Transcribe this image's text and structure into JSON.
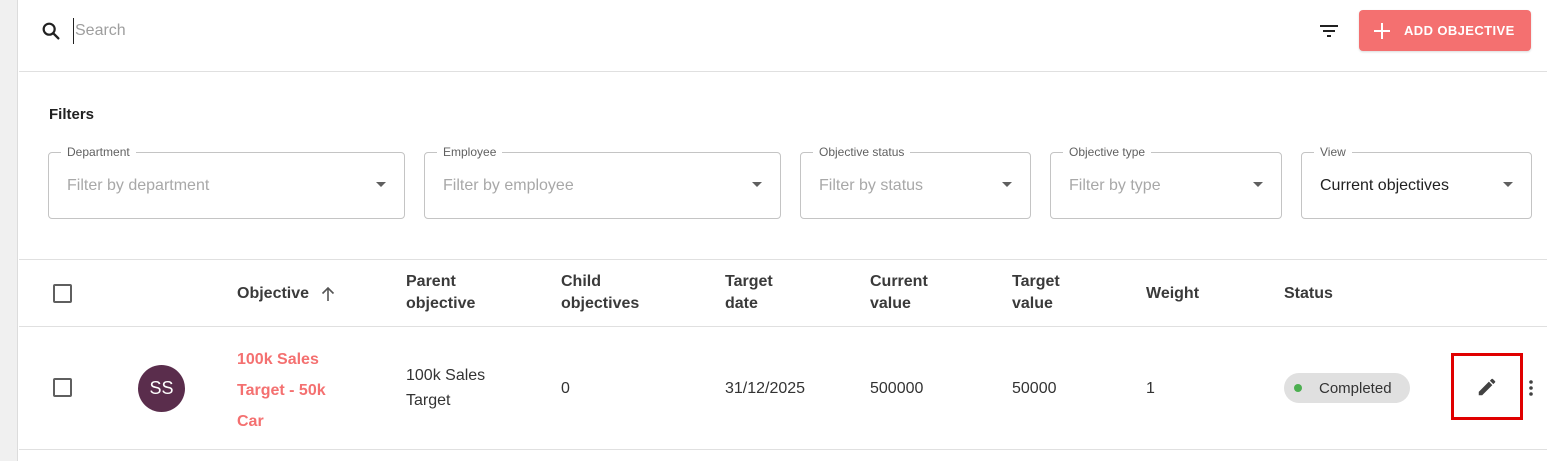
{
  "search": {
    "placeholder": "Search",
    "icon": "search-icon"
  },
  "toolbar": {
    "add_label": "ADD OBJECTIVE",
    "accent": "#f47070",
    "filter_icon": "filter-list-icon"
  },
  "filters": {
    "title": "Filters",
    "fields": [
      {
        "label": "Department",
        "value": "Filter by department"
      },
      {
        "label": "Employee",
        "value": "Filter by employee"
      },
      {
        "label": "Objective status",
        "value": "Filter by status"
      },
      {
        "label": "Objective type",
        "value": "Filter by type"
      },
      {
        "label": "View",
        "value": "Current objectives"
      }
    ]
  },
  "table": {
    "headers": {
      "objective": "Objective",
      "parent_1": "Parent",
      "parent_2": "objective",
      "child_1": "Child",
      "child_2": "objectives",
      "target_date_1": "Target",
      "target_date_2": "date",
      "current_value_1": "Current",
      "current_value_2": "value",
      "target_value_1": "Target",
      "target_value_2": "value",
      "weight": "Weight",
      "status": "Status"
    },
    "rows": [
      {
        "avatar": "SS",
        "objective_1": "100k Sales",
        "objective_2": "Target - 50k",
        "objective_3": "Car",
        "parent_1": "100k Sales",
        "parent_2": "Target",
        "child_objectives": "0",
        "target_date": "31/12/2025",
        "current_value": "500000",
        "target_value": "50000",
        "weight": "1",
        "status": "Completed"
      }
    ]
  },
  "colors": {
    "accent": "#f47070",
    "avatar": "#5a2d4c",
    "status_dot": "#4caf50",
    "highlight": "#e00000"
  }
}
